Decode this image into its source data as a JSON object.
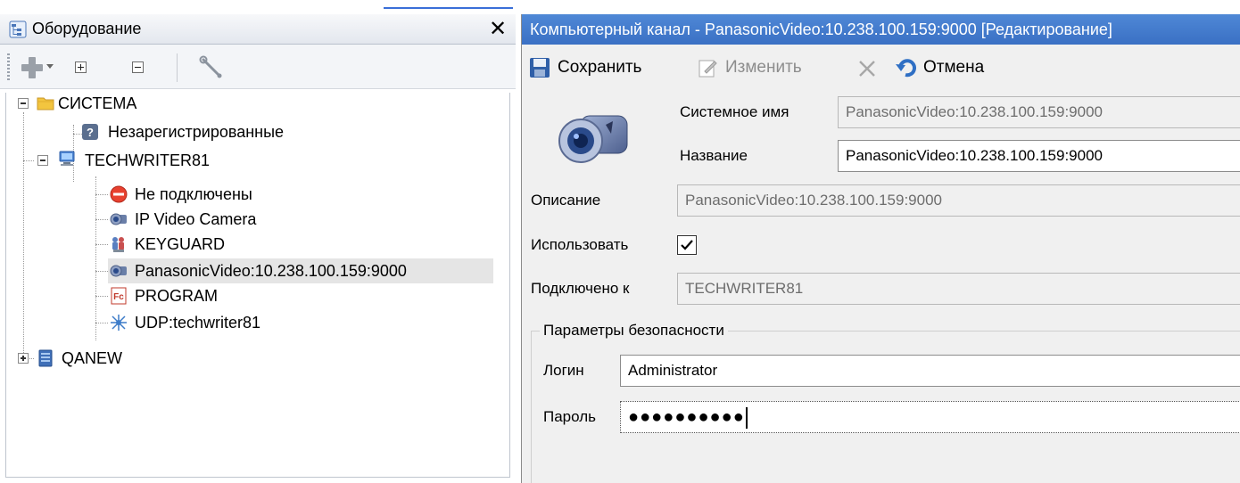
{
  "left_panel": {
    "title": "Оборудование",
    "close_glyph": "✕",
    "toolbar": {
      "icons": [
        "add-icon",
        "dropdown-arrow-icon",
        "expand-all-icon",
        "collapse-all-icon",
        "wrench-icon"
      ]
    },
    "tree": {
      "root": {
        "label": "СИСТЕМА",
        "expanded": true,
        "icon": "folder-icon"
      },
      "items": [
        {
          "label": "Незарегистрированные",
          "icon": "question-icon"
        },
        {
          "label": "TECHWRITER81",
          "icon": "computer-icon",
          "expanded": true,
          "children": [
            {
              "label": "Не подключены",
              "icon": "no-entry-icon"
            },
            {
              "label": "IP Video Camera",
              "icon": "camera-icon"
            },
            {
              "label": "KEYGUARD",
              "icon": "keyguard-icon"
            },
            {
              "label": "PanasonicVideo:10.238.100.159:9000",
              "icon": "camera-icon",
              "selected": true
            },
            {
              "label": "PROGRAM",
              "icon": "program-icon"
            },
            {
              "label": "UDP:techwriter81",
              "icon": "network-icon"
            }
          ]
        },
        {
          "label": "QANEW",
          "icon": "server-icon",
          "expanded": false
        }
      ]
    }
  },
  "right_panel": {
    "title": "Компьютерный канал - PanasonicVideo:10.238.100.159:9000 [Редактирование]",
    "toolbar": {
      "save_label": "Сохранить",
      "edit_label": "Изменить",
      "cancel_label": "Отмена"
    },
    "form": {
      "system_name_label": "Системное имя",
      "system_name_value": "PanasonicVideo:10.238.100.159:9000",
      "name_label": "Название",
      "name_value": "PanasonicVideo:10.238.100.159:9000",
      "description_label": "Описание",
      "description_value": "PanasonicVideo:10.238.100.159:9000",
      "use_label": "Использовать",
      "use_checked": true,
      "connected_label": "Подключено к",
      "connected_value": "TECHWRITER81"
    },
    "security": {
      "caption": "Параметры безопасности",
      "login_label": "Логин",
      "login_value": "Administrator",
      "password_label": "Пароль",
      "password_value": "●●●●●●●●●●"
    }
  }
}
